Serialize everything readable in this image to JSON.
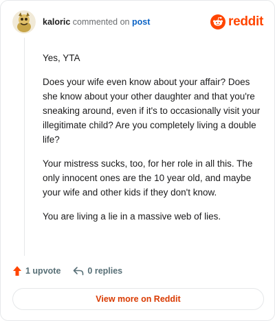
{
  "header": {
    "username": "kaloric",
    "action_text": "commented on",
    "post_link": "post"
  },
  "brand": {
    "logo_text": "reddit",
    "color": "#ff4500"
  },
  "comment": {
    "paragraphs": [
      "Yes, YTA",
      "Does your wife even know about your affair? Does she know about your other daughter and that you're sneaking around, even if it's to occasionally visit your illegitimate child? Are you completely living a double life?",
      "Your mistress sucks, too, for her role in all this. The only innocent ones are the 10 year old, and maybe your wife and other kids if they don't know.",
      "You are living a lie in a massive web of lies."
    ]
  },
  "actions": {
    "upvote_label": "1 upvote",
    "replies_label": "0 replies"
  },
  "footer": {
    "view_more_label": "View more on Reddit"
  },
  "icons": [
    "avatar",
    "reddit-logo-icon",
    "upvote-arrow-icon",
    "reply-arrow-icon"
  ]
}
